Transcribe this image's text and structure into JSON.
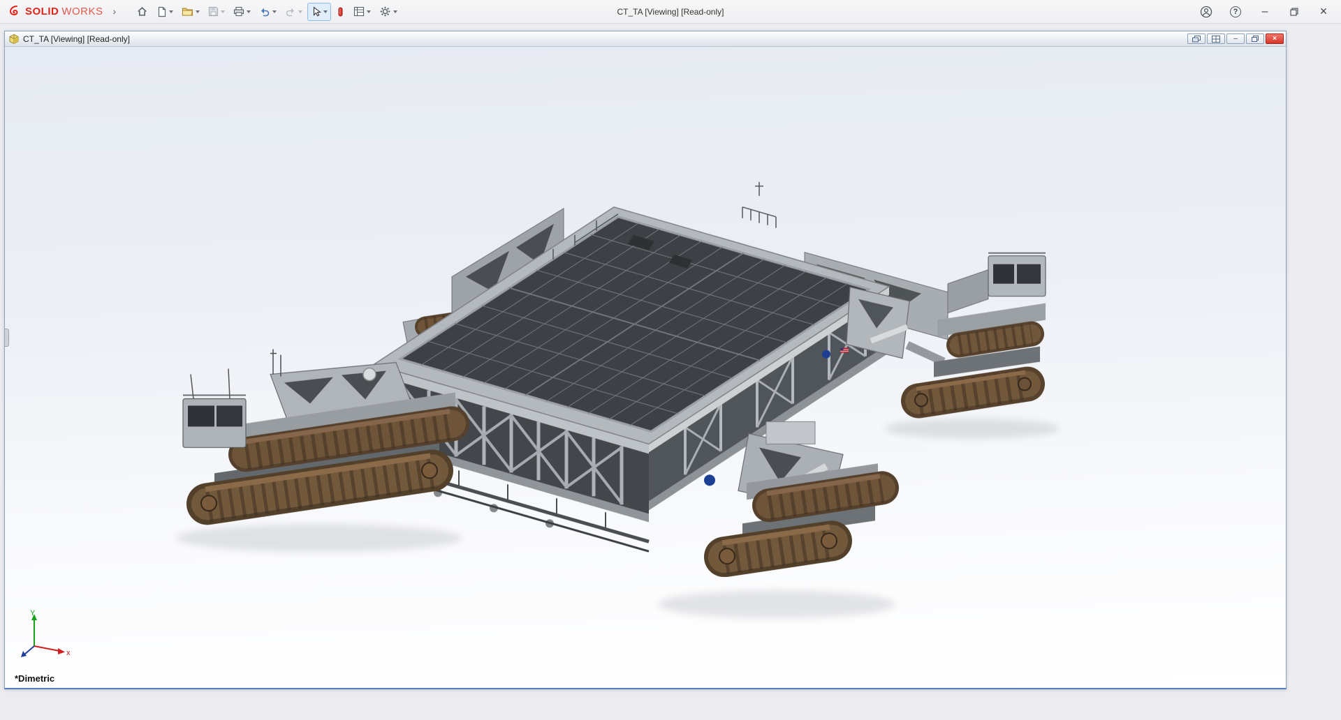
{
  "app_titlebar": {
    "brand_solid": "SOLID",
    "brand_works": "WORKS",
    "document_title": "CT_TA [Viewing] [Read-only]"
  },
  "toolbar": {
    "buttons": [
      "home",
      "new-document",
      "open",
      "save",
      "print",
      "undo",
      "redo",
      "select",
      "record-macro",
      "display-options",
      "settings"
    ]
  },
  "icons": {
    "expand_chevron": "›",
    "help_glyph": "?",
    "minimize_glyph": "–",
    "close_glyph": "×"
  },
  "child_window": {
    "title": "CT_TA [Viewing] [Read-only]",
    "minimize_glyph": "–",
    "close_glyph": "×"
  },
  "viewport": {
    "view_label": "*Dimetric",
    "triad": {
      "x_label": "x",
      "y_label": "Y"
    }
  },
  "colors": {
    "brand_red": "#e2231a",
    "child_close_red": "#d6362a",
    "track_brown": "#5d452f",
    "deck_gray": "#3d4145",
    "platform_gray": "#b4b9bd",
    "viewport_top": "#e6eaf2",
    "viewport_bottom": "#ffffff"
  }
}
